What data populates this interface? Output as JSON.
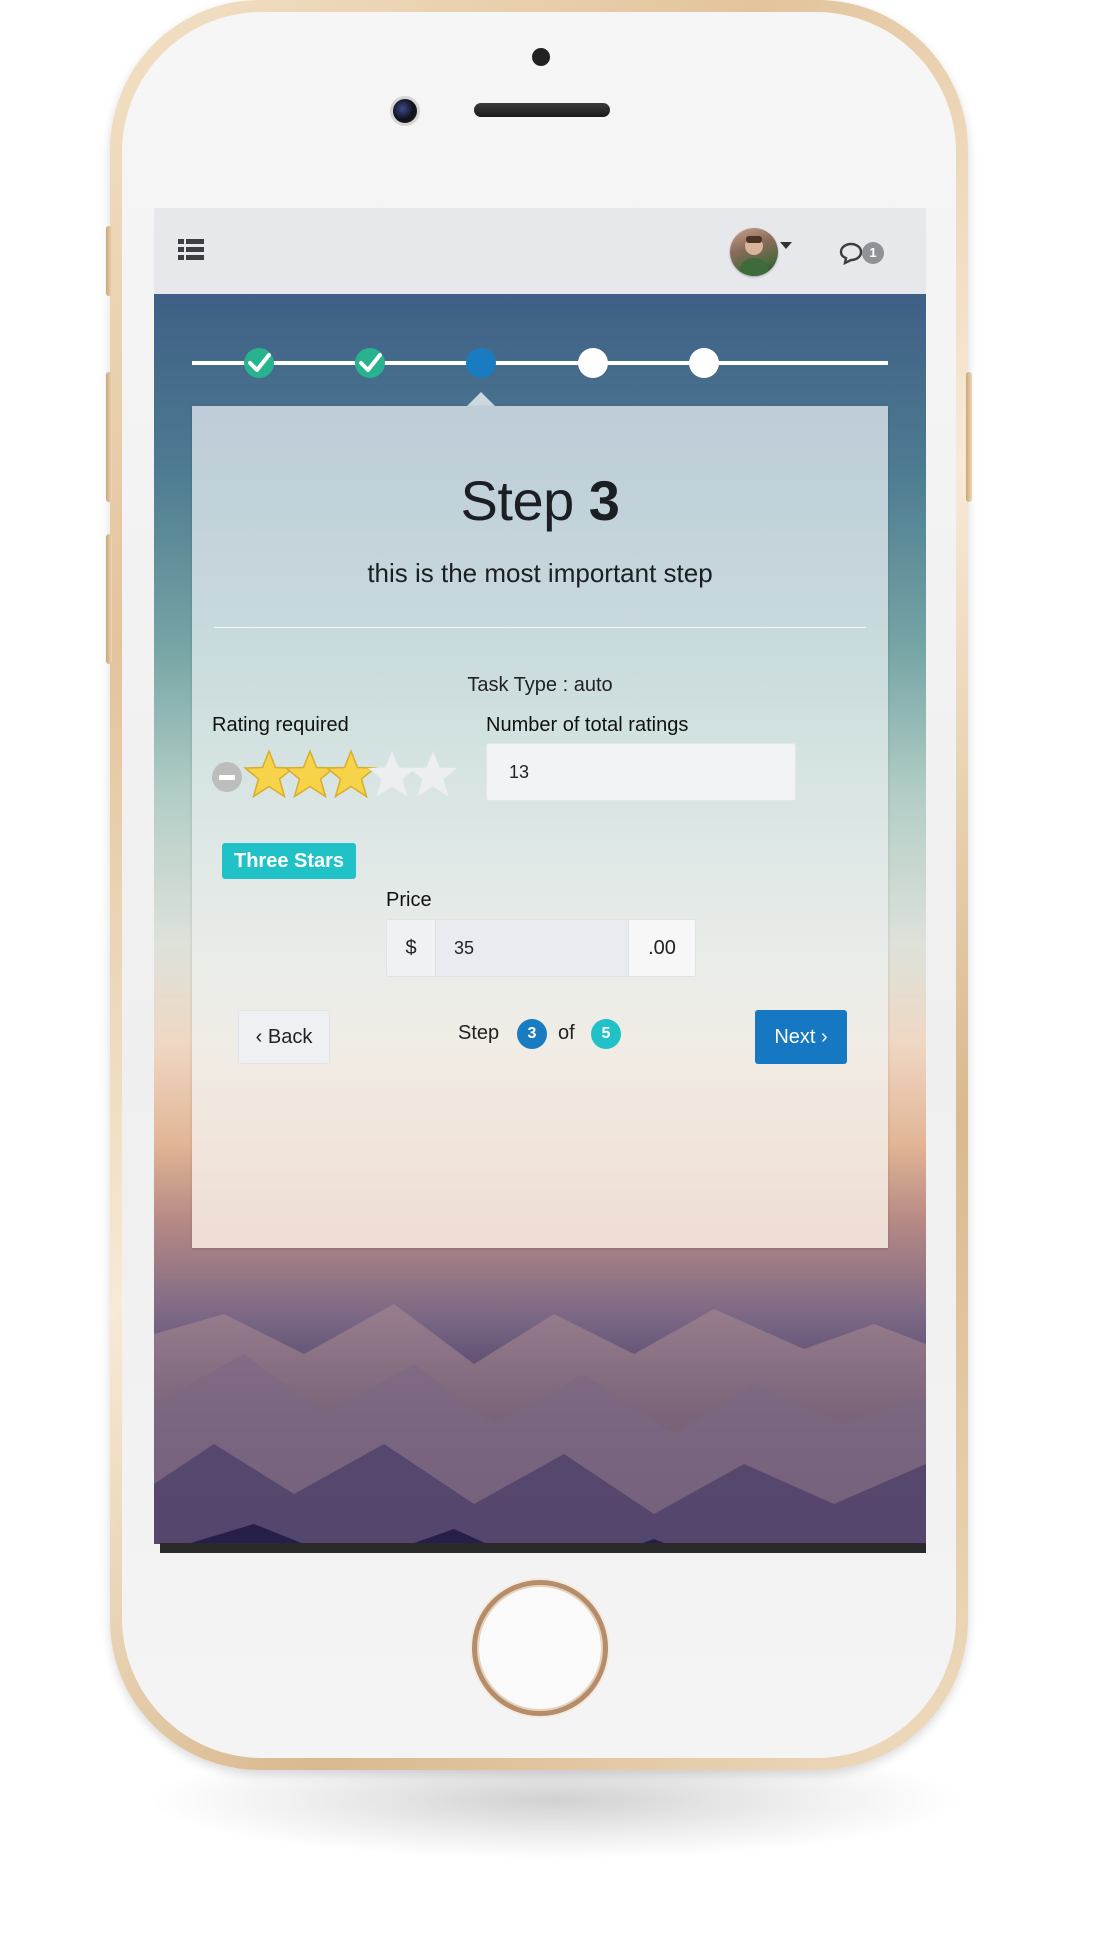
{
  "header": {
    "menu_icon": "list-icon",
    "chat_icon": "comments-icon",
    "chat_count": "1"
  },
  "wizard": {
    "total_steps": 5,
    "current_step": 3,
    "steps": [
      {
        "state": "done"
      },
      {
        "state": "done"
      },
      {
        "state": "current"
      },
      {
        "state": "todo"
      },
      {
        "state": "todo"
      }
    ],
    "title_prefix": "Step",
    "title_number": "3",
    "subtitle": "this is the most important step",
    "task_type": "Task Type : auto",
    "rating_label": "Rating required",
    "rating_value": 3,
    "rating_max": 5,
    "rating_text": "Three Stars",
    "total_ratings_label": "Number of total ratings",
    "total_ratings_value": "13",
    "price_label": "Price",
    "price_currency": "$",
    "price_value": "35",
    "price_suffix": ".00",
    "back_label": "Back",
    "next_label": "Next",
    "pager_step_label": "Step",
    "pager_current": "3",
    "pager_of_label": "of",
    "pager_total": "5"
  },
  "colors": {
    "done": "#27b38e",
    "current": "#1a7cc0",
    "next_button": "#1678c2",
    "badge_teal": "#20c2c7",
    "star_fill": "#f7d34a"
  }
}
